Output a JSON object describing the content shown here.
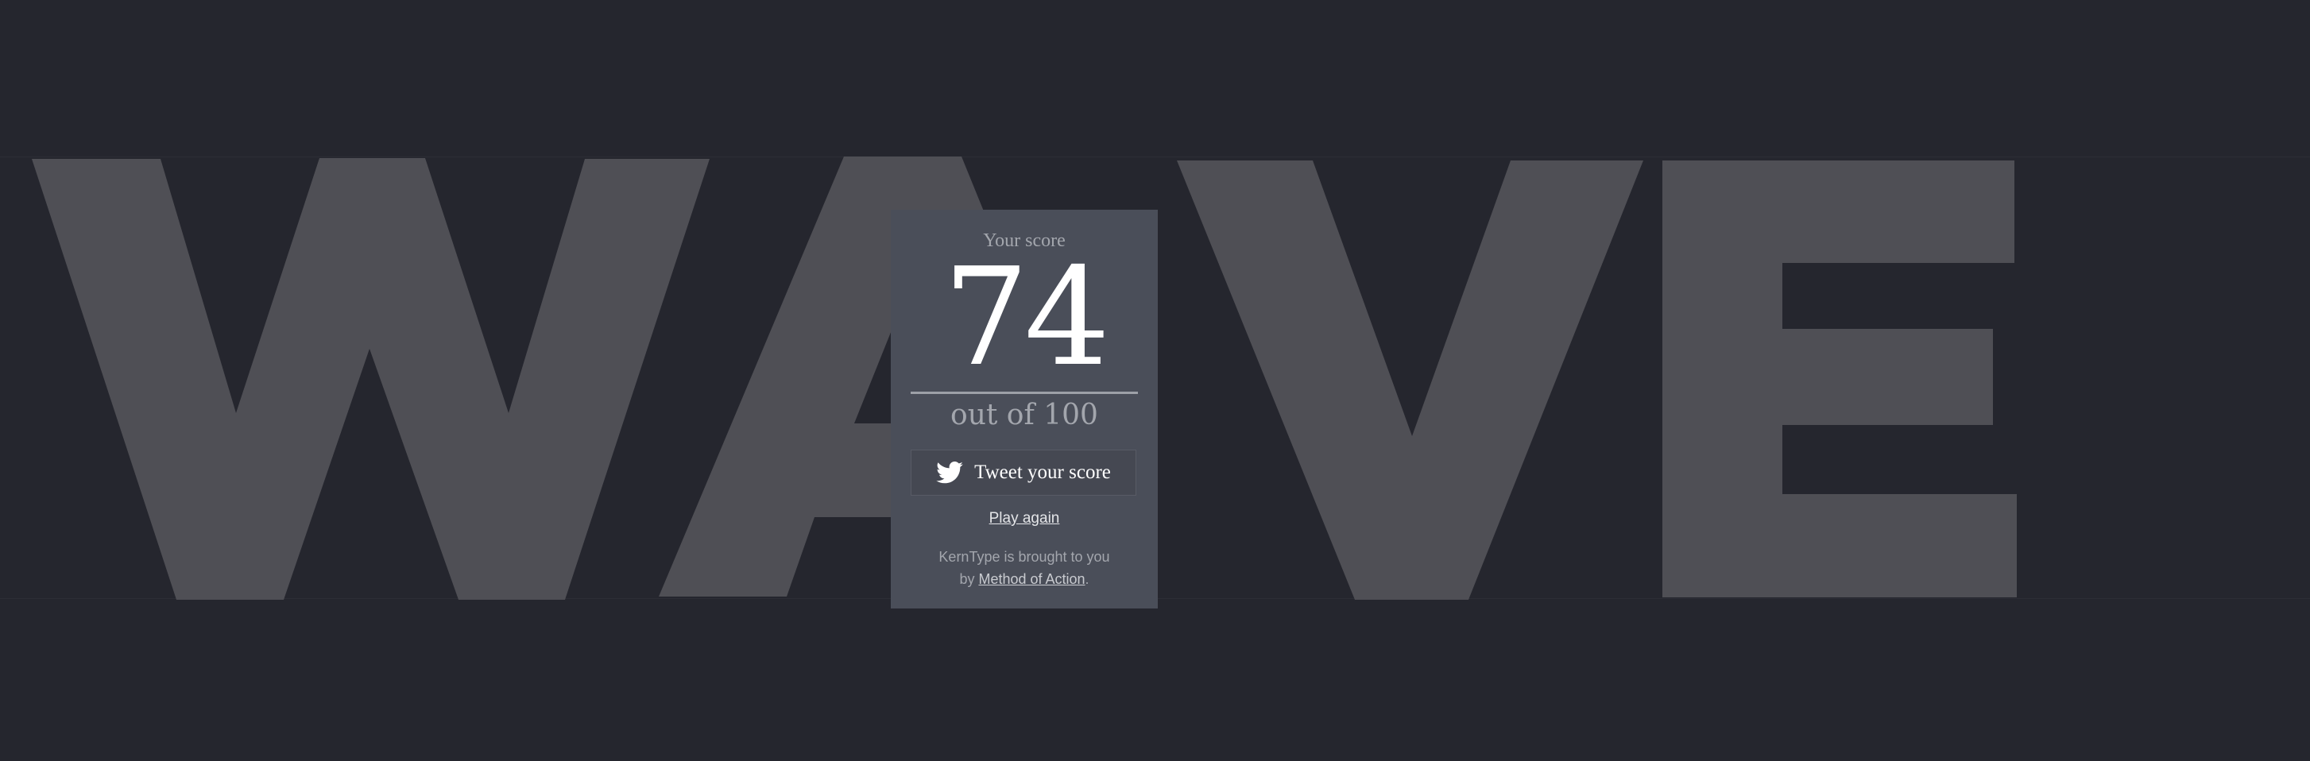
{
  "game": {
    "word": "WAVE",
    "colors": {
      "background": "#25262e",
      "letters": "#4f4f55",
      "panel": "#4a4e59"
    }
  },
  "result": {
    "score_label": "Your score",
    "score": "74",
    "score_total_text": "out of 100",
    "tweet_label": "Tweet your score",
    "tweet_icon": "twitter-bird-icon",
    "play_again_label": "Play again",
    "credit_prefix_line1": "KernType is brought to you",
    "credit_prefix_line2": "by ",
    "credit_link_label": "Method of Action",
    "credit_suffix": "."
  }
}
